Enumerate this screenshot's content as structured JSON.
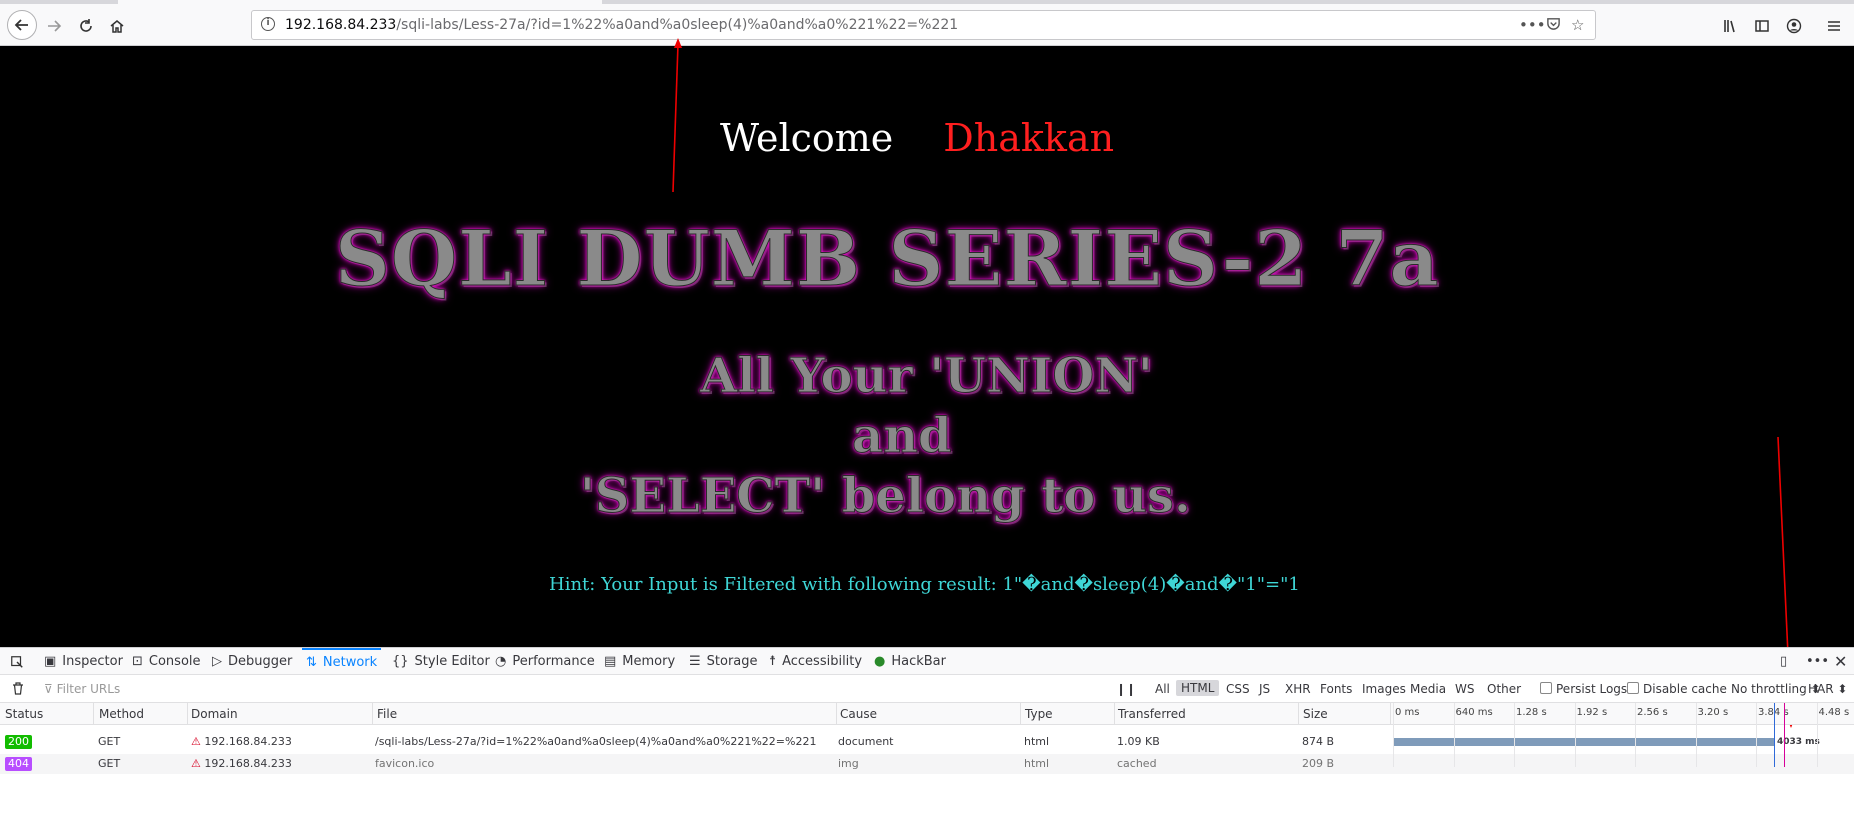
{
  "browser": {
    "url_host": "192.168.84.233",
    "url_path": "/sqli-labs/Less-27a/?id=1%22%a0and%a0sleep(4)%a0and%a0%221%22=%221",
    "nav_icons": [
      "back-icon",
      "forward-icon",
      "reload-icon",
      "home-icon"
    ],
    "right_icons": [
      "library-icon",
      "sidebar-icon",
      "account-icon",
      "menu-icon"
    ]
  },
  "page": {
    "welcome": "Welcome",
    "name": "Dhakkan",
    "title": "SQLI DUMB SERIES-2 7a",
    "line1": "All Your 'UNION'",
    "line2": "and",
    "line3": "'SELECT' belong to us.",
    "hint": "Hint: Your Input is Filtered with following result: 1\"�and�sleep(4)�and�\"1\"=\"1"
  },
  "devtools": {
    "tabs": [
      "Inspector",
      "Console",
      "Debugger",
      "Network",
      "Style Editor",
      "Performance",
      "Memory",
      "Storage",
      "Accessibility",
      "HackBar"
    ],
    "selected_tab": "Network",
    "filter_placeholder": "Filter URLs",
    "type_filters": [
      "All",
      "HTML",
      "CSS",
      "JS",
      "XHR",
      "Fonts",
      "Images",
      "Media",
      "WS",
      "Other"
    ],
    "selected_filter": "HTML",
    "persist_logs": "Persist Logs",
    "disable_cache": "Disable cache",
    "throttling": "No throttling",
    "har": "HAR",
    "columns": [
      "Status",
      "Method",
      "Domain",
      "File",
      "Cause",
      "Type",
      "Transferred",
      "Size"
    ],
    "timeline_ticks": [
      "0 ms",
      "640 ms",
      "1.28 s",
      "1.92 s",
      "2.56 s",
      "3.20 s",
      "3.84 s",
      "4.48 s"
    ],
    "requests": [
      {
        "status": "200",
        "status_color": "#12bc00",
        "method": "GET",
        "domain": "192.168.84.233",
        "file": "/sqli-labs/Less-27a/?id=1%22%a0and%a0sleep(4)%a0and%a0%221%22=%221",
        "cause": "document",
        "type": "html",
        "transferred": "1.09 KB",
        "size": "874 B",
        "timing": "4033 ms",
        "duration_ms": 4033
      },
      {
        "status": "404",
        "status_color": "#b84eff",
        "method": "GET",
        "domain": "192.168.84.233",
        "file": "favicon.ico",
        "cause": "img",
        "type": "html",
        "transferred": "cached",
        "size": "209 B"
      }
    ]
  }
}
